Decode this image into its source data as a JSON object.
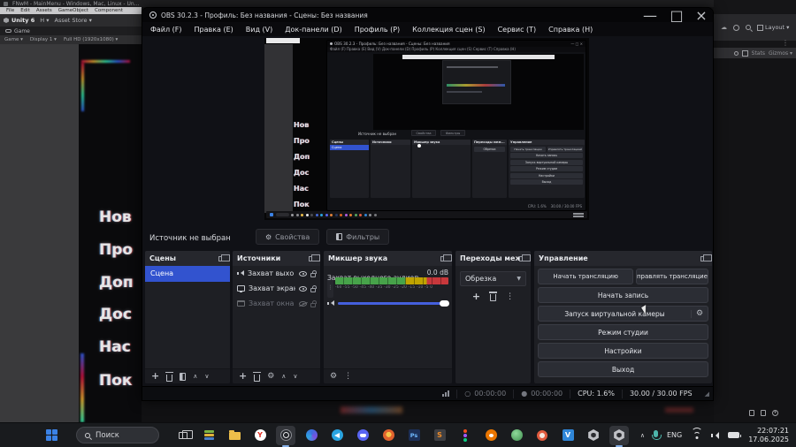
{
  "colors": {
    "scene-selected": "#3253cf",
    "slider": "#4560dd",
    "meter-green": "#47a34a",
    "meter-yellow": "#bfa300",
    "meter-red": "#c8383c",
    "start-blue": "#3b82e6",
    "folder-yellow": "#edbe4a",
    "telegram-blue": "#2aa4e0",
    "discord-blurple": "#5865f2",
    "blender-orange": "#ea7600",
    "vscode-blue": "#2f86d8",
    "photoshop-navy": "#1c2f57",
    "photoshop-text": "#6fb8ff",
    "yandex-red": "#e03226",
    "mic-teal": "#4db6ac"
  },
  "unity": {
    "window_title": "FNwM - MainMenu - Windows, Mac, Linux - Un...",
    "menu": [
      "File",
      "Edit",
      "Assets",
      "GameObject",
      "Component"
    ],
    "toolbar": {
      "version": "Unity 6",
      "account": "H",
      "asset_store": "Asset Store"
    },
    "game_tab": "Game",
    "game_toolbar": {
      "view": "Game",
      "display": "Display 1",
      "resolution": "Full HD (1920x1080)"
    },
    "right_toolbar": {
      "layout": "Layout",
      "stats": "Stats",
      "gizmos": "Gizmos"
    },
    "window_controls": {
      "minimize": "—",
      "maximize": "□",
      "close": "×"
    },
    "game_menu_items": [
      "Нов",
      "Про",
      "Доп",
      "Дос",
      "Нас",
      "Пок"
    ]
  },
  "obs": {
    "title": "OBS 30.2.3 - Профиль: Без названия - Сцены: Без названия",
    "window_controls": {
      "minimize": "—",
      "maximize": "□",
      "close": "×"
    },
    "menu": [
      "Файл (F)",
      "Правка (E)",
      "Вид (V)",
      "Док-панели (D)",
      "Профиль (P)",
      "Коллекция сцен (S)",
      "Сервис (T)",
      "Справка (H)"
    ],
    "menu_line": "Файл (F)   Правка (E)   Вид (V)   Док-панели (D)   Профиль (P)   Коллекция сцен (S)   Сервис (T)   Справка (H)",
    "no_source": "Источник не выбран",
    "properties_btn": "Свойства",
    "filters_btn": "Фильтры",
    "panels": {
      "scenes": {
        "title": "Сцены",
        "items": [
          "Сцена"
        ]
      },
      "sources": {
        "title": "Источники",
        "items": [
          {
            "label": "Захват выхо"
          },
          {
            "label": "Захват экран"
          },
          {
            "label": "Захват окна"
          }
        ]
      },
      "mixer": {
        "title": "Микшер звука",
        "source": "Захват выходного аудиопотока",
        "db": "0.0 dB",
        "ticks": "-60 -55 -50 -45 -40 -35 -30 -25 -20 -15 -10 -5 0"
      },
      "transitions": {
        "title": "Переходы меж...",
        "selected": "Обрезка"
      },
      "controls": {
        "title": "Управление",
        "buttons": [
          "Начать трансляцию",
          "Управлять трансляцией",
          "Начать запись",
          "Запуск виртуальной камеры",
          "Режим студии",
          "Настройки",
          "Выход"
        ]
      }
    },
    "status": {
      "stream_time": "00:00:00",
      "rec_time": "00:00:00",
      "cpu": "CPU: 1.6%",
      "fps": "30.00 / 30.00 FPS"
    }
  },
  "taskbar": {
    "search_placeholder": "Поиск",
    "language": "ENG",
    "time": "22:07:21",
    "date": "17.06.2025",
    "pinned_apps": [
      "task-view",
      "archive-app",
      "file-explorer",
      "yandex-browser",
      "obs-studio",
      "paint-3d",
      "telegram",
      "discord",
      "store-app",
      "photoshop",
      "substance",
      "figma",
      "blender",
      "green-sphere-app",
      "ring-app",
      "vscode",
      "unity-hub",
      "unity-editor"
    ],
    "app_labels": {
      "photoshop": "Ps",
      "substance": "S",
      "vscode": "V",
      "yandex": "Y"
    },
    "active_apps": [
      "obs-studio",
      "unity-editor"
    ]
  }
}
